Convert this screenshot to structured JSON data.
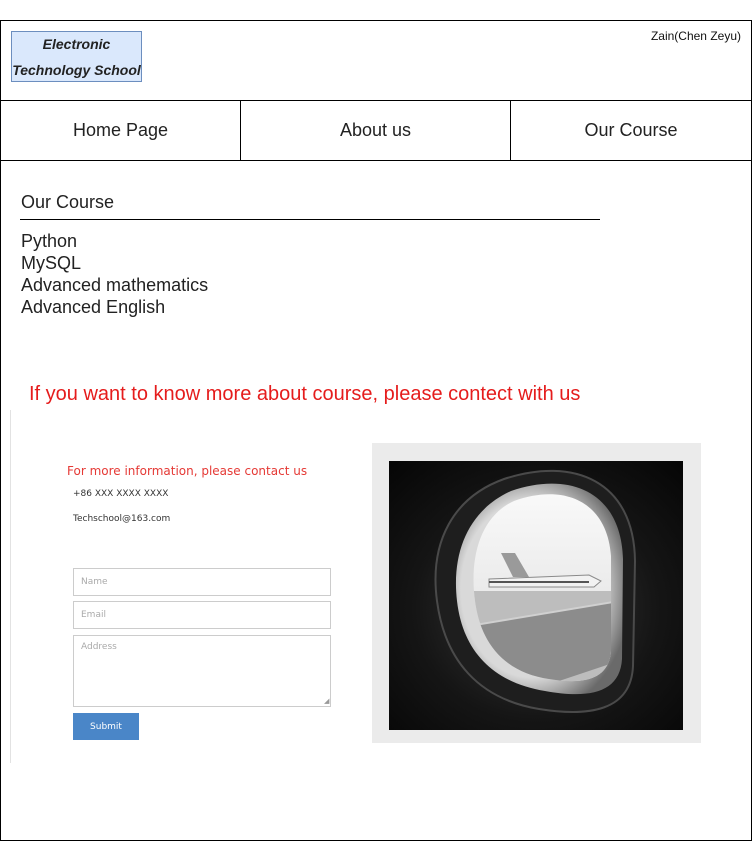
{
  "header": {
    "logo_line1": "Electronic",
    "logo_line2": "Technology School",
    "user": "Zain(Chen Zeyu)"
  },
  "nav": {
    "home": "Home Page",
    "about": "About us",
    "course": "Our Course"
  },
  "courses": {
    "title": "Our Course",
    "items": [
      "Python",
      "MySQL",
      "Advanced mathematics",
      "Advanced English"
    ]
  },
  "cta": "If you want to know more about course, please contect with us",
  "contact": {
    "heading": "For more information, please contact us",
    "phone": "+86 XXX XXXX XXXX",
    "email": "Techschool@163.com"
  },
  "form": {
    "name_placeholder": "Name",
    "email_placeholder": "Email",
    "address_placeholder": "Address",
    "submit_label": "Submit"
  },
  "colors": {
    "logo_fill": "#dae8fc",
    "logo_border": "#6c8ebf",
    "cta_red": "#e51c1c",
    "submit_blue": "#4a86c8"
  },
  "photo": {
    "icon": "airplane-window-photo"
  }
}
